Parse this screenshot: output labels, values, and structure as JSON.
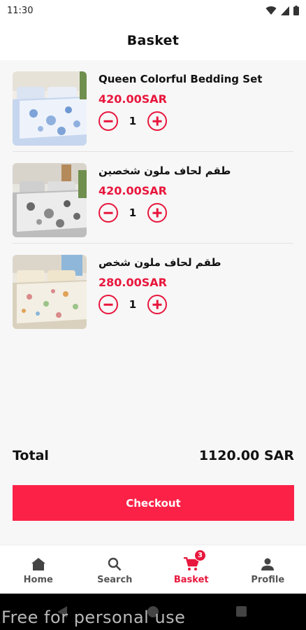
{
  "status_bar": {
    "time": "11:30"
  },
  "header": {
    "title": "Basket"
  },
  "cart": {
    "items": [
      {
        "name": "Queen Colorful Bedding Set",
        "price": "420.00SAR",
        "quantity": "1"
      },
      {
        "name": "طقم لحاف ملون شخصين",
        "price": "420.00SAR",
        "quantity": "1"
      },
      {
        "name": "طقم لحاف ملون شخص",
        "price": "280.00SAR",
        "quantity": "1"
      }
    ]
  },
  "summary": {
    "total_label": "Total",
    "total_value": "1120.00 SAR"
  },
  "checkout": {
    "label": "Checkout"
  },
  "nav": {
    "items": [
      {
        "label": "Home",
        "icon": "home-icon"
      },
      {
        "label": "Search",
        "icon": "search-icon"
      },
      {
        "label": "Basket",
        "icon": "cart-icon",
        "badge": "3",
        "active": true
      },
      {
        "label": "Profile",
        "icon": "person-icon"
      }
    ]
  },
  "watermark": "Free for personal use",
  "colors": {
    "accent": "#e8173d",
    "button": "#fc2147"
  }
}
